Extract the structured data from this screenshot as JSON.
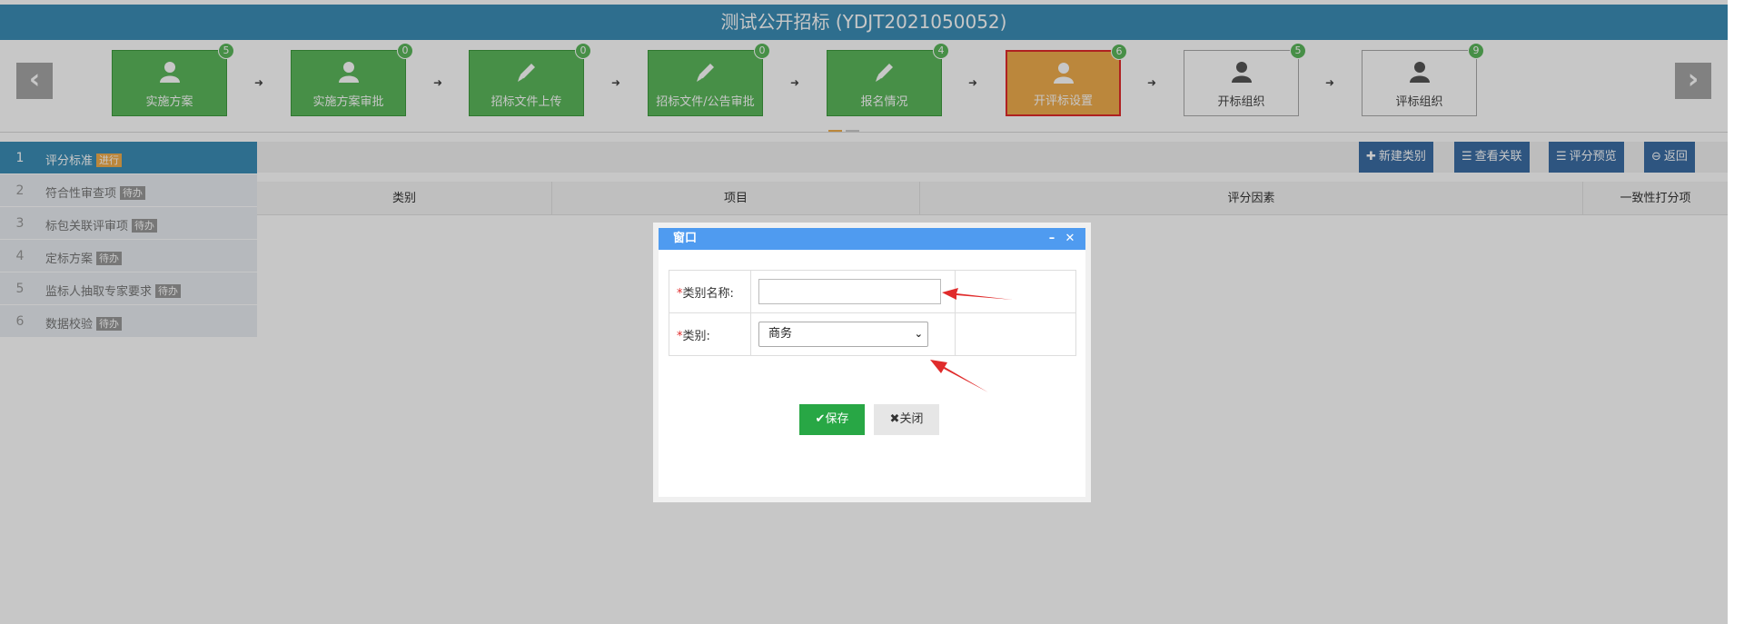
{
  "header": {
    "title": "测试公开招标 (YDJT2021050052)"
  },
  "steps": {
    "prev_label": "‹",
    "next_label": "›",
    "items": [
      {
        "label": "实施方案",
        "count": "5",
        "icon": "user-icon",
        "state": "done"
      },
      {
        "label": "实施方案审批",
        "count": "0",
        "icon": "user-icon",
        "state": "done"
      },
      {
        "label": "招标文件上传",
        "count": "0",
        "icon": "pencil-icon",
        "state": "done"
      },
      {
        "label": "招标文件/公告审批",
        "count": "0",
        "icon": "pencil-icon",
        "state": "done"
      },
      {
        "label": "报名情况",
        "count": "4",
        "icon": "pencil-icon",
        "state": "done"
      },
      {
        "label": "开评标设置",
        "count": "6",
        "icon": "user-icon",
        "state": "active"
      },
      {
        "label": "开标组织",
        "count": "5",
        "icon": "user-icon",
        "state": "todo"
      },
      {
        "label": "评标组织",
        "count": "9",
        "icon": "user-icon",
        "state": "todo"
      }
    ]
  },
  "sidebar": {
    "items": [
      {
        "num": "1",
        "label": "评分标准",
        "tag": "进行"
      },
      {
        "num": "2",
        "label": "符合性审查项",
        "tag": "待办"
      },
      {
        "num": "3",
        "label": "标包关联评审项",
        "tag": "待办"
      },
      {
        "num": "4",
        "label": "定标方案",
        "tag": "待办"
      },
      {
        "num": "5",
        "label": "监标人抽取专家要求",
        "tag": "待办"
      },
      {
        "num": "6",
        "label": "数据校验",
        "tag": "待办"
      }
    ]
  },
  "toolbar": {
    "new_category": "新建类别",
    "view_relation": "查看关联",
    "score_preview": "评分预览",
    "back": "返回"
  },
  "table": {
    "headers": [
      "类别",
      "项目",
      "评分因素",
      "一致性打分项"
    ]
  },
  "dialog": {
    "title": "窗口",
    "minimize": "–",
    "close": "✕",
    "name_label": "类别名称:",
    "name_value": "",
    "type_label": "类别:",
    "type_value": "商务",
    "required_mark": "*",
    "save_label": "保存",
    "close_label": "关闭"
  },
  "colors": {
    "accent": "#3b8eb6",
    "done": "#5cb85c",
    "active": "#f0ad4e",
    "dialog_header": "#4f9bf0",
    "arrow": "#e02b2b"
  }
}
